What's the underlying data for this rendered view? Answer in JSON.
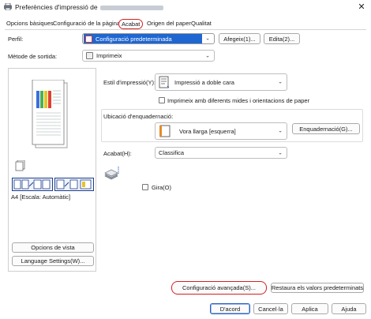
{
  "window": {
    "title": "Preferències d'impressió de",
    "close_glyph": "✕"
  },
  "tabs": [
    {
      "label": "Opcions bàsiques"
    },
    {
      "label": "Configuració de la pàgina"
    },
    {
      "label": "Acabat"
    },
    {
      "label": "Origen del paper"
    },
    {
      "label": "Qualitat"
    }
  ],
  "profile": {
    "label": "Perfil:",
    "value": "Configuració predeterminada",
    "add_button": "Afegeix(1)...",
    "edit_button": "Edita(2)..."
  },
  "output_method": {
    "label": "Mètode de sortida:",
    "value": "Imprimeix"
  },
  "preview": {
    "caption": "A4 [Escala: Automàtic]",
    "view_options_button": "Opcions de vista",
    "language_button": "Language Settings(W)..."
  },
  "print_style": {
    "label": "Estil d'impressió(Y):",
    "value": "Impressió a doble cara",
    "mixed_sizes_label": "Imprimeix amb diferents mides i orientacions de paper"
  },
  "binding": {
    "group_label": "Ubicació d'enquadernació:",
    "value": "Vora llarga [esquerra]",
    "binding_button": "Enquadernació(G)..."
  },
  "finishing": {
    "label": "Acabat(H):",
    "value": "Classifica",
    "rotate_label": "Gira(O)"
  },
  "buttons": {
    "advanced": "Configuració avançada(S)...",
    "restore": "Restaura els valors predeterminats",
    "ok": "D'acord",
    "cancel": "Cancel·la",
    "apply": "Aplica",
    "help": "Ajuda"
  },
  "colors": {
    "accent": "#1f66d1",
    "highlight_ring": "#d62020"
  }
}
